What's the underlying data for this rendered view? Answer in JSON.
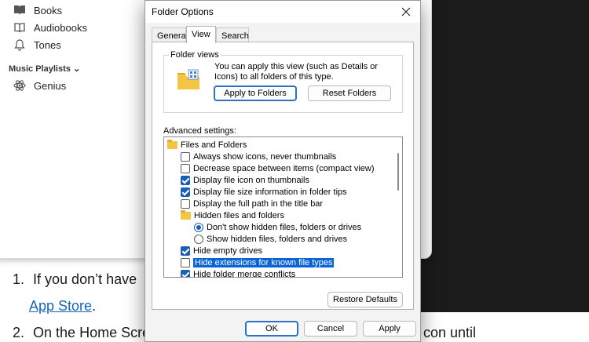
{
  "background": {
    "library_items": [
      "Books",
      "Audiobooks",
      "Tones"
    ],
    "section_label": "Music Playlists",
    "playlist_item": "Genius",
    "article": {
      "step1_num": "1.",
      "step1_text": "If you don’t have",
      "step1_link": "App Store",
      "step1_tail": ".",
      "step2_num": "2.",
      "step2_text": "On the Home Scre",
      "step2_tail": "con until"
    }
  },
  "dialog": {
    "title": "Folder Options",
    "tabs": [
      "General",
      "View",
      "Search"
    ],
    "active_tab": "View",
    "folder_views": {
      "legend": "Folder views",
      "description": "You can apply this view (such as Details or Icons) to all folders of this type.",
      "apply_button": "Apply to Folders",
      "reset_button": "Reset Folders"
    },
    "advanced_label": "Advanced settings:",
    "tree": [
      {
        "type": "folder",
        "label": "Files and Folders"
      },
      {
        "type": "checkbox",
        "label": "Always show icons, never thumbnails",
        "checked": false
      },
      {
        "type": "checkbox",
        "label": "Decrease space between items (compact view)",
        "checked": false
      },
      {
        "type": "checkbox",
        "label": "Display file icon on thumbnails",
        "checked": true
      },
      {
        "type": "checkbox",
        "label": "Display file size information in folder tips",
        "checked": true
      },
      {
        "type": "checkbox",
        "label": "Display the full path in the title bar",
        "checked": false
      },
      {
        "type": "folder",
        "label": "Hidden files and folders"
      },
      {
        "type": "radio",
        "label": "Don't show hidden files, folders or drives",
        "checked": true
      },
      {
        "type": "radio",
        "label": "Show hidden files, folders and drives",
        "checked": false
      },
      {
        "type": "checkbox",
        "label": "Hide empty drives",
        "checked": true
      },
      {
        "type": "checkbox",
        "label": "Hide extensions for known file types",
        "checked": false,
        "selected": true
      },
      {
        "type": "checkbox",
        "label": "Hide folder merge conflicts",
        "checked": true
      }
    ],
    "restore_button": "Restore Defaults",
    "ok_button": "OK",
    "cancel_button": "Cancel",
    "apply_button": "Apply",
    "colors": {
      "accent": "#1a5fb4",
      "selection": "#0a64d6",
      "folder": "#f4c542"
    }
  }
}
